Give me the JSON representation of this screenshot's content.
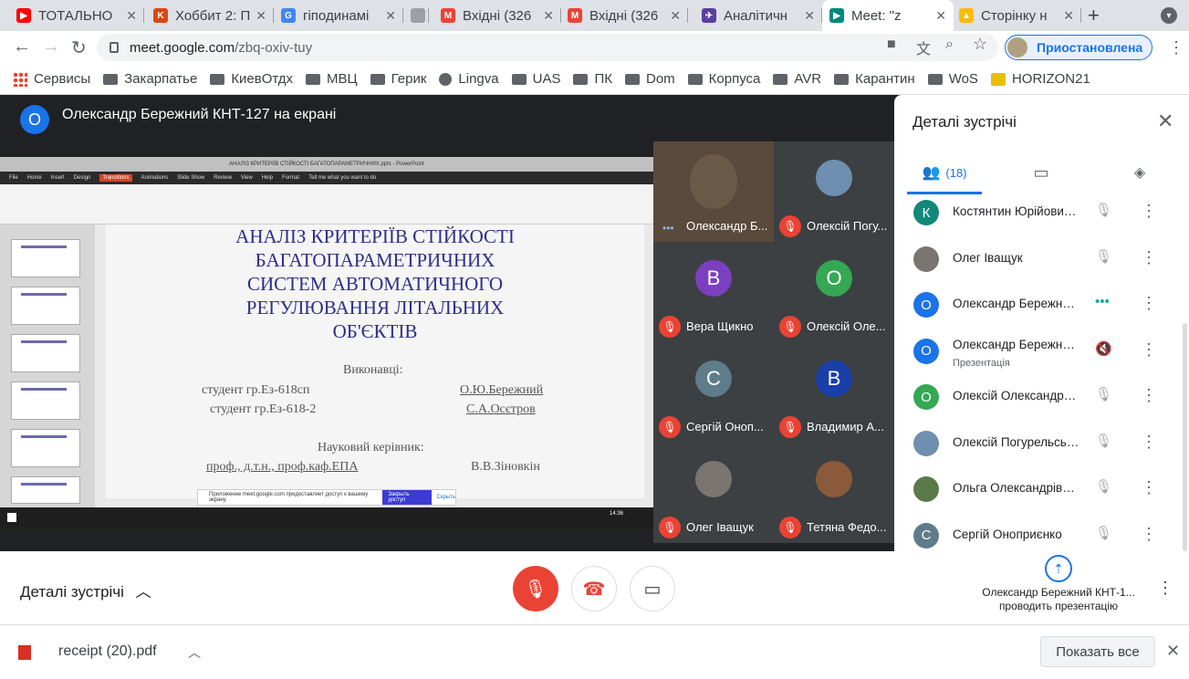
{
  "tabs": [
    {
      "title": "ТОТАЛЬНО",
      "icon": "youtube-icon",
      "color": "#ff0000",
      "glyph": "▶"
    },
    {
      "title": "Хоббит 2: П",
      "icon": "kinopoisk-icon",
      "color": "#d9480f",
      "glyph": "K"
    },
    {
      "title": "гіподинамі",
      "icon": "google-icon",
      "color": "#4285f4",
      "glyph": "G"
    },
    {
      "title": "",
      "icon": "blank-page-icon",
      "color": "#9aa0a6",
      "glyph": ""
    },
    {
      "title": "Вхідні (326",
      "icon": "gmail-icon",
      "color": "#ea4335",
      "glyph": "M"
    },
    {
      "title": "Вхідні (326",
      "icon": "gmail-icon",
      "color": "#ea4335",
      "glyph": "M"
    },
    {
      "title": "Аналітичн",
      "icon": "app-icon",
      "color": "#5b3fa0",
      "glyph": "✈"
    },
    {
      "title": "Meet: \"z",
      "icon": "meet-icon",
      "color": "#00897b",
      "glyph": "▶"
    },
    {
      "title": "Сторінку н",
      "icon": "drive-icon",
      "color": "#fbbc04",
      "glyph": "▲"
    }
  ],
  "browser": {
    "url_host": "meet.google.com",
    "url_path": "/zbq-oxiv-tuy",
    "profile_label": "Приостановлена"
  },
  "bookmarks": [
    {
      "label": "Сервисы",
      "icon": "apps-grid-icon"
    },
    {
      "label": "Закарпатье",
      "icon": "folder-icon"
    },
    {
      "label": "КиевОтдх",
      "icon": "folder-icon"
    },
    {
      "label": "МВЦ",
      "icon": "folder-icon"
    },
    {
      "label": "Герик",
      "icon": "folder-icon"
    },
    {
      "label": "Lingva",
      "icon": "globe-icon"
    },
    {
      "label": "UAS",
      "icon": "folder-icon"
    },
    {
      "label": "ПК",
      "icon": "folder-icon"
    },
    {
      "label": "Dom",
      "icon": "folder-icon"
    },
    {
      "label": "Корпуса",
      "icon": "folder-icon"
    },
    {
      "label": "AVR",
      "icon": "folder-icon"
    },
    {
      "label": "Карантин",
      "icon": "folder-icon"
    },
    {
      "label": "WoS",
      "icon": "folder-icon"
    },
    {
      "label": "HORIZON21",
      "icon": "horizon-icon"
    }
  ],
  "meet": {
    "presenter_initial": "О",
    "presenter_title": "Олександр Бережний КНТ-127 на екрані"
  },
  "shared_screen": {
    "window_title": "АНАЛІЗ КРИТЕРІЇВ СТІЙКОСТІ БАГАТОПАРАМЕТРИЧНИХ.pptx - PowerPoint",
    "menu": [
      "File",
      "Home",
      "Insert",
      "Design",
      "Transitions",
      "Animations",
      "Slide Show",
      "Review",
      "View",
      "Help",
      "Format",
      "Tell me what you want to do"
    ],
    "slide_title": "АНАЛІЗ КРИТЕРІЇВ СТІЙКОСТІ\nБАГАТОПАРАМЕТРИЧНИХ\nСИСТЕМ АВТОМАТИЧНОГО\nРЕГУЛЮВАННЯ ЛІТАЛЬНИХ\nОБ'ЄКТІВ",
    "performers_label": "Виконавці:",
    "student1": "студент гр.Ез-618сп",
    "student1_name": "О.Ю.Бережний",
    "student2": "студент гр.Ез-618-2",
    "student2_name": "С.А.Осєтров",
    "supervisor_label": "Науковий керівник:",
    "supervisor_title": "проф., д.т.н., проф.каф.ЕПА",
    "supervisor_name": "В.В.Зіновкін",
    "share_notice": "Приложение meet.google.com предоставляет доступ к вашему экрану.",
    "share_stop": "Закрыть доступ",
    "share_hide": "Скрыть",
    "clock": "14:36"
  },
  "tiles": [
    {
      "name": "Олександр Б...",
      "initial": "",
      "color": "#6b5a48",
      "muted": false
    },
    {
      "name": "Олексій Погу...",
      "initial": "",
      "color": "#6f8fb0",
      "muted": true
    },
    {
      "name": "Вера Щикно",
      "initial": "В",
      "color": "#7b3fbf",
      "muted": true
    },
    {
      "name": "Олексій Оле...",
      "initial": "О",
      "color": "#34a853",
      "muted": true
    },
    {
      "name": "Сергій Оноп...",
      "initial": "С",
      "color": "#5f7c8a",
      "muted": true
    },
    {
      "name": "Владимир А...",
      "initial": "В",
      "color": "#1a3fa8",
      "muted": true
    },
    {
      "name": "Олег Іващук",
      "initial": "",
      "color": "#7a7570",
      "muted": true
    },
    {
      "name": "Тетяна Федо...",
      "initial": "",
      "color": "#8a5a3a",
      "muted": true
    }
  ],
  "panel": {
    "title": "Деталі зустрічі",
    "people_count": "(18)",
    "people": [
      {
        "name": "Костянтин Юрійович ...",
        "initial": "К",
        "color": "#12887a",
        "sub": "",
        "status": "muted"
      },
      {
        "name": "Олег Іващук",
        "initial": "",
        "color": "#7a7570",
        "sub": "",
        "status": "muted"
      },
      {
        "name": "Олександр Бережний ...",
        "initial": "О",
        "color": "#1a73e8",
        "sub": "",
        "status": "speaking"
      },
      {
        "name": "Олександр Бережний ...",
        "initial": "О",
        "color": "#1a73e8",
        "sub": "Презентація",
        "status": "presenting"
      },
      {
        "name": "Олексій Олександров...",
        "initial": "О",
        "color": "#34a853",
        "sub": "",
        "status": "muted"
      },
      {
        "name": "Олексій Погурельський",
        "initial": "",
        "color": "#6f8fb0",
        "sub": "",
        "status": "muted"
      },
      {
        "name": "Ольга Олександрівна ...",
        "initial": "",
        "color": "#5b7a4a",
        "sub": "",
        "status": "muted"
      },
      {
        "name": "Сергій Оноприєнко",
        "initial": "С",
        "color": "#5f7c8a",
        "sub": "",
        "status": "muted"
      }
    ]
  },
  "bottom": {
    "details_label": "Деталі зустрічі",
    "presenting_text": "Олександр Бережний КНТ-1... проводить презентацію"
  },
  "downloads": {
    "file_name": "receipt (20).pdf",
    "show_all": "Показать все"
  }
}
